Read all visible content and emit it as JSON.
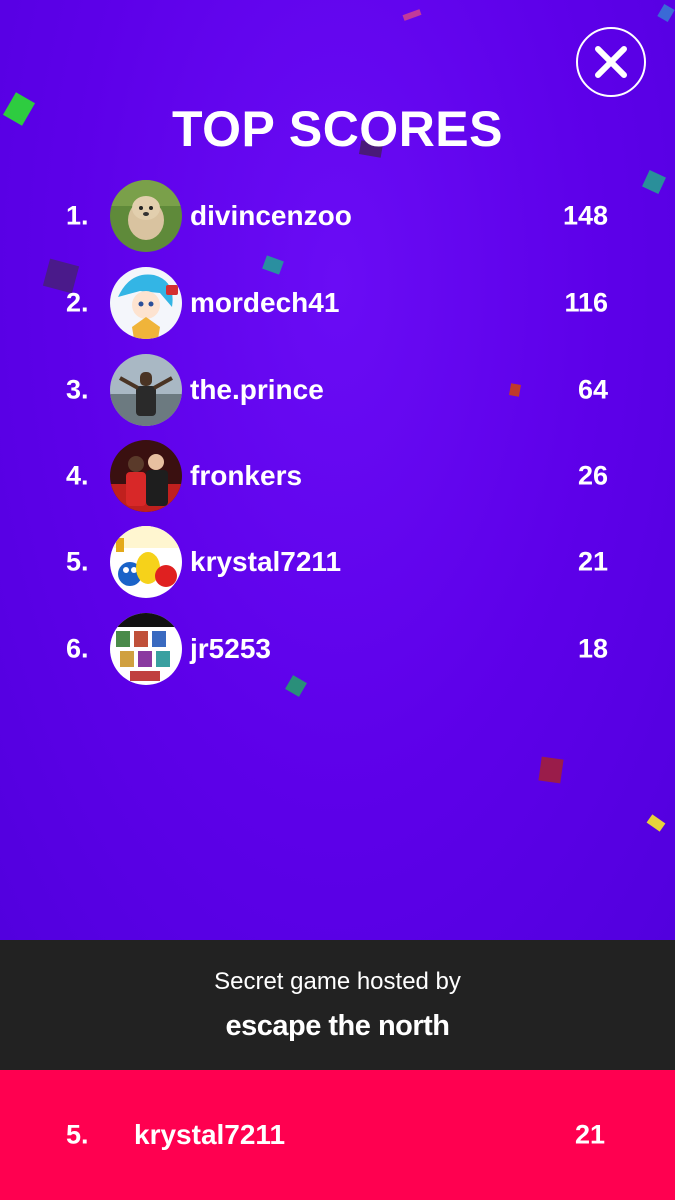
{
  "title": "TOP SCORES",
  "close_icon": "close-icon",
  "leaderboard": [
    {
      "rank": "1.",
      "username": "divincenzoo",
      "score": "148",
      "avatar": "dog-photo"
    },
    {
      "rank": "2.",
      "username": "mordech41",
      "score": "116",
      "avatar": "anime-character"
    },
    {
      "rank": "3.",
      "username": "the.prince",
      "score": "64",
      "avatar": "person-photo"
    },
    {
      "rank": "4.",
      "username": "fronkers",
      "score": "26",
      "avatar": "two-people-photo"
    },
    {
      "rank": "5.",
      "username": "krystal7211",
      "score": "21",
      "avatar": "sesame-street-birthday"
    },
    {
      "rank": "6.",
      "username": "jr5253",
      "score": "18",
      "avatar": "ultimate-collage"
    }
  ],
  "host": {
    "label": "Secret game hosted by",
    "name": "escape the north"
  },
  "my_score": {
    "rank": "5.",
    "username": "krystal7211",
    "score": "21"
  },
  "colors": {
    "background": "#5e00e8",
    "host_bar": "#222222",
    "my_score_bar": "#ff0050"
  }
}
